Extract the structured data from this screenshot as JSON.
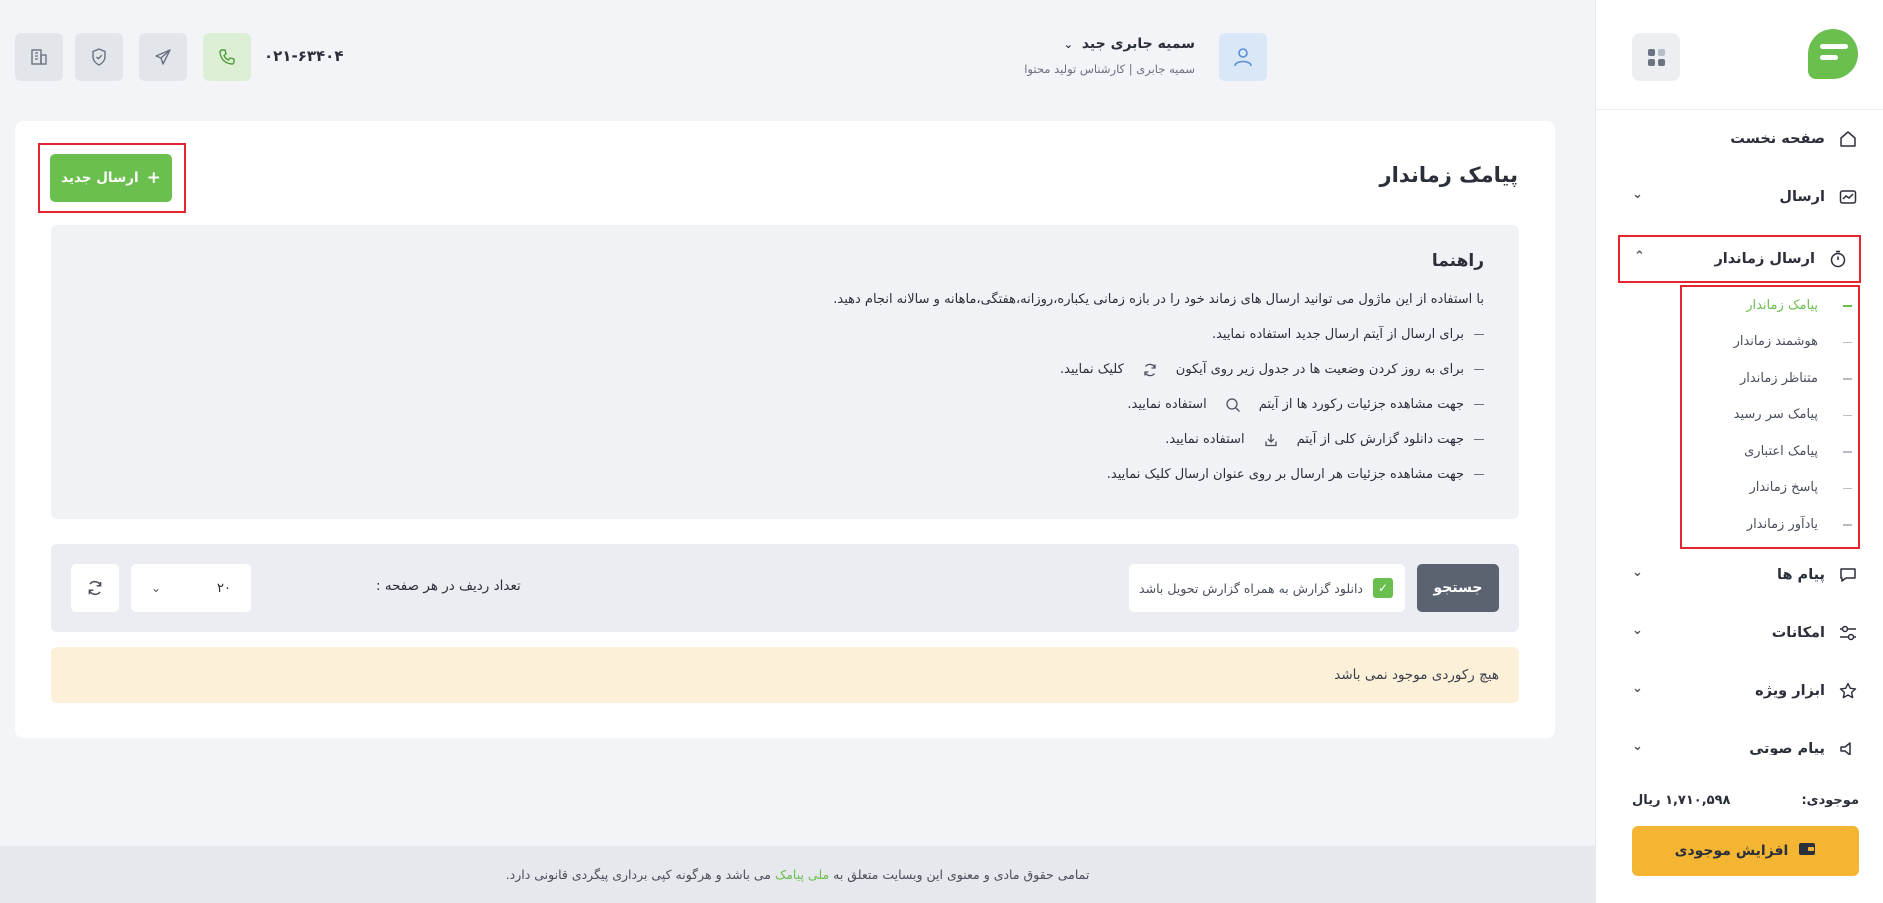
{
  "header": {
    "user_name": "سمیه جابری جید",
    "user_role": "سمیه جابری | کارشناس تولید محتوا",
    "phone": "۰۲۱-۶۳۴۰۴"
  },
  "sidebar": {
    "items": [
      {
        "label": "صفحه نخست",
        "icon": "home-icon"
      },
      {
        "label": "ارسال",
        "icon": "send-chart-icon"
      },
      {
        "label": "ارسال زماندار",
        "icon": "timer-icon"
      },
      {
        "label": "پیام ها",
        "icon": "chat-icon"
      },
      {
        "label": "امکانات",
        "icon": "sliders-icon"
      },
      {
        "label": "ابزار ویژه",
        "icon": "star-icon"
      },
      {
        "label": "پیام صوتی",
        "icon": "speaker-icon"
      }
    ],
    "submenu": [
      "پیامک زماندار",
      "هوشمند زماندار",
      "متناظر زماندار",
      "پیامک سر رسید",
      "پیامک اعتباری",
      "پاسخ زماندار",
      "یادآور زماندار"
    ],
    "balance_label": "موجودی:",
    "balance_value": "۱,۷۱۰,۵۹۸ ریال",
    "topup_label": "افزایش موجودی"
  },
  "main": {
    "title": "پیامک زماندار",
    "new_button": "ارسال جدید",
    "guide": {
      "title": "راهنما",
      "intro": "با استفاده از این ماژول می توانید ارسال های زماند خود را در بازه زمانی یکباره،روزانه،هفتگی،ماهانه و سالانه انجام دهید.",
      "line1": "برای ارسال از آیتم ارسال جدید استفاده نمایید.",
      "line2a": "برای به روز کردن وضعیت ها در جدول زیر روی آیکون",
      "line2b": "کلیک نمایید.",
      "line3a": "جهت مشاهده جزئیات رکورد ها از آیتم",
      "line3b": "استفاده نمایید.",
      "line4a": "جهت دانلود گزارش کلی از آیتم",
      "line4b": "استفاده نمایید.",
      "line5": "جهت مشاهده جزئیات هر ارسال بر روی عنوان ارسال کلیک نمایید."
    },
    "filters": {
      "search": "جستجو",
      "checkbox_label": "دانلود گزارش به همراه گزارش تحویل باشد",
      "rows_label": "تعداد ردیف در هر صفحه :",
      "rows_value": "۲۰"
    },
    "empty_message": "هیچ رکوردی موجود نمی باشد"
  },
  "footer": {
    "text_before": "تمامی حقوق مادی و معنوی این وبسایت متعلق به",
    "brand": "ملی پیامک",
    "text_after": "می باشد و هرگونه کپی برداری پیگردی قانونی دارد."
  },
  "colors": {
    "accent": "#6bbf4e",
    "warning": "#f4b632",
    "highlight": "#e3262f"
  }
}
